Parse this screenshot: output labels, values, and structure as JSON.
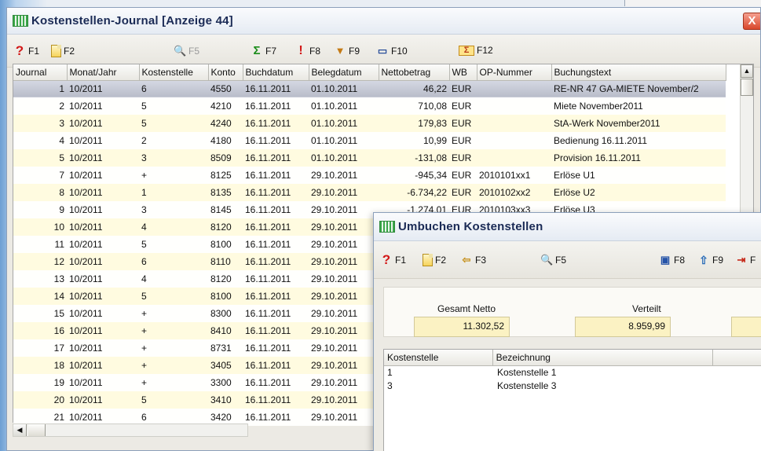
{
  "main_window": {
    "title": "Kostenstellen-Journal  [Anzeige 44]",
    "close_label": "X",
    "toolbar": {
      "f1": "F1",
      "f2": "F2",
      "f5": "F5",
      "f7": "F7",
      "f8": "F8",
      "f9": "F9",
      "f10": "F10",
      "f12": "F12"
    },
    "columns": [
      "Journal",
      "Monat/Jahr",
      "Kostenstelle",
      "Konto",
      "Buchdatum",
      "Belegdatum",
      "Nettobetrag",
      "WB",
      "OP-Nummer",
      "Buchungstext"
    ],
    "rows": [
      {
        "journal": "1",
        "monat": "10/2011",
        "ks": "6",
        "konto": "4550",
        "buch": "16.11.2011",
        "beleg": "01.10.2011",
        "netto": "46,22",
        "wb": "EUR",
        "op": "",
        "text": "RE-NR 47 GA-MIETE November/2"
      },
      {
        "journal": "2",
        "monat": "10/2011",
        "ks": "5",
        "konto": "4210",
        "buch": "16.11.2011",
        "beleg": "01.10.2011",
        "netto": "710,08",
        "wb": "EUR",
        "op": "",
        "text": "Miete November2011"
      },
      {
        "journal": "3",
        "monat": "10/2011",
        "ks": "5",
        "konto": "4240",
        "buch": "16.11.2011",
        "beleg": "01.10.2011",
        "netto": "179,83",
        "wb": "EUR",
        "op": "",
        "text": "StA-Werk November2011"
      },
      {
        "journal": "4",
        "monat": "10/2011",
        "ks": "2",
        "konto": "4180",
        "buch": "16.11.2011",
        "beleg": "01.10.2011",
        "netto": "10,99",
        "wb": "EUR",
        "op": "",
        "text": "Bedienung 16.11.2011"
      },
      {
        "journal": "5",
        "monat": "10/2011",
        "ks": "3",
        "konto": "8509",
        "buch": "16.11.2011",
        "beleg": "01.10.2011",
        "netto": "-131,08",
        "wb": "EUR",
        "op": "",
        "text": "Provision 16.11.2011"
      },
      {
        "journal": "7",
        "monat": "10/2011",
        "ks": "+",
        "konto": "8125",
        "buch": "16.11.2011",
        "beleg": "29.10.2011",
        "netto": "-945,34",
        "wb": "EUR",
        "op": "2010101xx1",
        "text": "Erlöse U1"
      },
      {
        "journal": "8",
        "monat": "10/2011",
        "ks": "1",
        "konto": "8135",
        "buch": "16.11.2011",
        "beleg": "29.10.2011",
        "netto": "-6.734,22",
        "wb": "EUR",
        "op": "2010102xx2",
        "text": "Erlöse U2"
      },
      {
        "journal": "9",
        "monat": "10/2011",
        "ks": "3",
        "konto": "8145",
        "buch": "16.11.2011",
        "beleg": "29.10.2011",
        "netto": "-1.274,01",
        "wb": "EUR",
        "op": "2010103xx3",
        "text": "Erlöse U3"
      },
      {
        "journal": "10",
        "monat": "10/2011",
        "ks": "4",
        "konto": "8120",
        "buch": "16.11.2011",
        "beleg": "29.10.2011",
        "netto": "",
        "wb": "",
        "op": "",
        "text": ""
      },
      {
        "journal": "11",
        "monat": "10/2011",
        "ks": "5",
        "konto": "8100",
        "buch": "16.11.2011",
        "beleg": "29.10.2011",
        "netto": "",
        "wb": "",
        "op": "",
        "text": ""
      },
      {
        "journal": "12",
        "monat": "10/2011",
        "ks": "6",
        "konto": "8110",
        "buch": "16.11.2011",
        "beleg": "29.10.2011",
        "netto": "",
        "wb": "",
        "op": "",
        "text": ""
      },
      {
        "journal": "13",
        "monat": "10/2011",
        "ks": "4",
        "konto": "8120",
        "buch": "16.11.2011",
        "beleg": "29.10.2011",
        "netto": "",
        "wb": "",
        "op": "",
        "text": ""
      },
      {
        "journal": "14",
        "monat": "10/2011",
        "ks": "5",
        "konto": "8100",
        "buch": "16.11.2011",
        "beleg": "29.10.2011",
        "netto": "",
        "wb": "",
        "op": "",
        "text": ""
      },
      {
        "journal": "15",
        "monat": "10/2011",
        "ks": "+",
        "konto": "8300",
        "buch": "16.11.2011",
        "beleg": "29.10.2011",
        "netto": "",
        "wb": "",
        "op": "",
        "text": ""
      },
      {
        "journal": "16",
        "monat": "10/2011",
        "ks": "+",
        "konto": "8410",
        "buch": "16.11.2011",
        "beleg": "29.10.2011",
        "netto": "",
        "wb": "",
        "op": "",
        "text": ""
      },
      {
        "journal": "17",
        "monat": "10/2011",
        "ks": "+",
        "konto": "8731",
        "buch": "16.11.2011",
        "beleg": "29.10.2011",
        "netto": "",
        "wb": "",
        "op": "",
        "text": ""
      },
      {
        "journal": "18",
        "monat": "10/2011",
        "ks": "+",
        "konto": "3405",
        "buch": "16.11.2011",
        "beleg": "29.10.2011",
        "netto": "",
        "wb": "",
        "op": "",
        "text": ""
      },
      {
        "journal": "19",
        "monat": "10/2011",
        "ks": "+",
        "konto": "3300",
        "buch": "16.11.2011",
        "beleg": "29.10.2011",
        "netto": "",
        "wb": "",
        "op": "",
        "text": ""
      },
      {
        "journal": "20",
        "monat": "10/2011",
        "ks": "5",
        "konto": "3410",
        "buch": "16.11.2011",
        "beleg": "29.10.2011",
        "netto": "",
        "wb": "",
        "op": "",
        "text": ""
      },
      {
        "journal": "21",
        "monat": "10/2011",
        "ks": "6",
        "konto": "3420",
        "buch": "16.11.2011",
        "beleg": "29.10.2011",
        "netto": "",
        "wb": "",
        "op": "",
        "text": ""
      }
    ]
  },
  "dialog": {
    "title": "Umbuchen Kostenstellen",
    "toolbar": {
      "f1": "F1",
      "f2": "F2",
      "f3": "F3",
      "f5": "F5",
      "f8": "F8",
      "f9": "F9",
      "f10": "F"
    },
    "gesamt_netto_label": "Gesamt Netto",
    "gesamt_netto_value": "11.302,52",
    "verteilt_label": "Verteilt",
    "verteilt_value": "8.959,99",
    "columns": [
      "Kostenstelle",
      "Bezeichnung"
    ],
    "rows": [
      {
        "ks": "1",
        "bez": "Kostenstelle 1"
      },
      {
        "ks": "3",
        "bez": "Kostenstelle 3"
      }
    ]
  }
}
